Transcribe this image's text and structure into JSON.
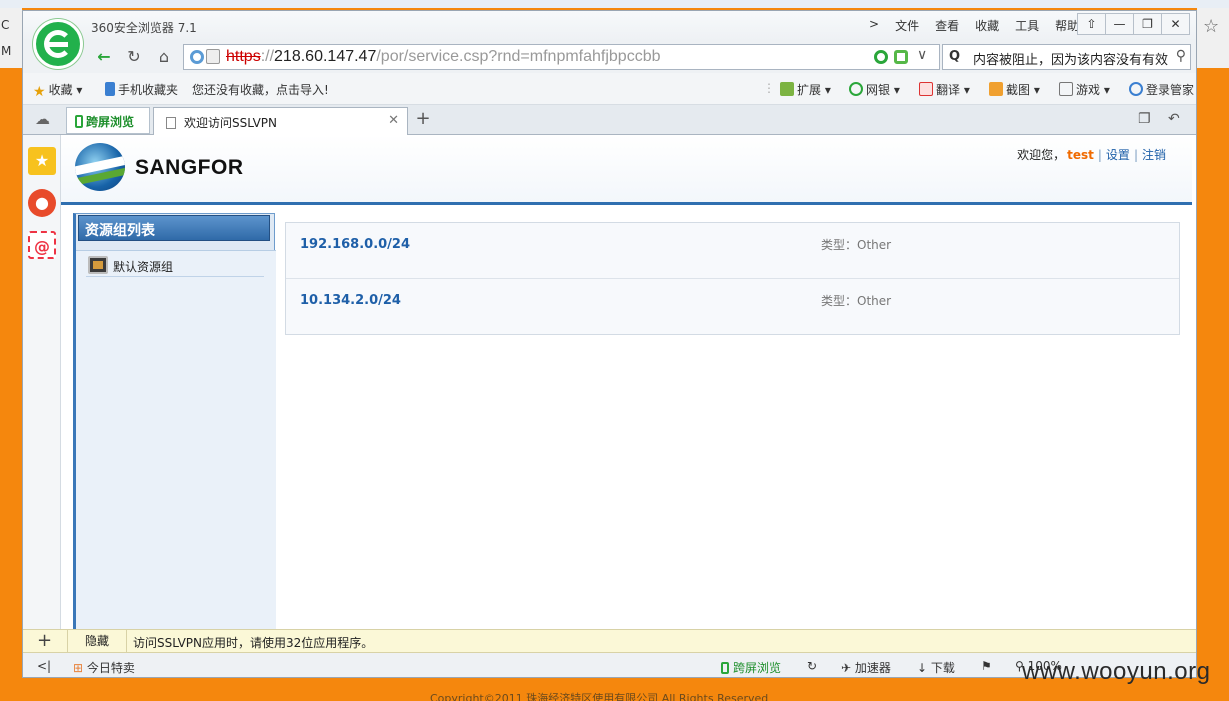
{
  "background": {
    "left_letters": [
      "C",
      "M"
    ],
    "copyright": "Copyright©2011 珠海经济特区使用有限公司 All Rights Reserved",
    "watermark": "www.wooyun.org"
  },
  "browser": {
    "app_title": "360安全浏览器 7.1",
    "menu": [
      ">",
      "文件",
      "查看",
      "收藏",
      "工具",
      "帮助"
    ],
    "window_controls": [
      "⇧",
      "—",
      "❐",
      "✕"
    ],
    "address": {
      "scheme": "https",
      "sep": "://",
      "host": "218.60.147.47",
      "path": "/por/service.csp?rnd=mfnpmfahfjbpccbb"
    },
    "search_text": "内容被阻止，因为该内容没有有效",
    "bookmarks": {
      "fav_label": "收藏",
      "mobile_label": "手机收藏夹",
      "import_hint": "您还没有收藏，点击导入!",
      "ext_label": "扩展",
      "bank_label": "网银",
      "translate_label": "翻译",
      "screenshot_label": "截图",
      "games_label": "游戏",
      "login_label": "登录管家"
    },
    "tabs": {
      "cross_screen": "跨屏浏览",
      "active_tab": "欢迎访问SSLVPN"
    },
    "notification": {
      "hide_label": "隐藏",
      "message": "访问SSLVPN应用时，请使用32位应用程序。"
    },
    "status_bar": {
      "today_deal": "今日特卖",
      "cross_screen": "跨屏浏览",
      "accelerator": "加速器",
      "download": "下载",
      "zoom": "100%"
    }
  },
  "page": {
    "brand": "SANGFOR",
    "welcome": "欢迎您，",
    "username": "test",
    "settings_link": "设置",
    "logout_link": "注销",
    "panel_title": "资源组列表",
    "groups": [
      {
        "name": "默认资源组"
      }
    ],
    "resources": [
      {
        "name": "192.168.0.0/24",
        "type": "类型：Other"
      },
      {
        "name": "10.134.2.0/24",
        "type": "类型：Other"
      }
    ]
  }
}
